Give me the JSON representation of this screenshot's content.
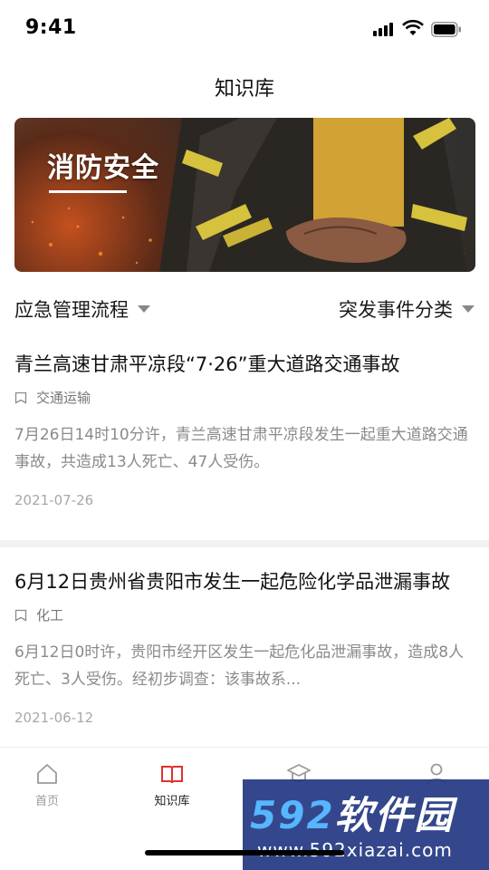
{
  "status": {
    "time": "9:41"
  },
  "header": {
    "title": "知识库"
  },
  "banner": {
    "text": "消防安全"
  },
  "filters": {
    "left": {
      "label": "应急管理流程"
    },
    "right": {
      "label": "突发事件分类"
    }
  },
  "articles": [
    {
      "title": "青兰高速甘肃平凉段“7·26”重大道路交通事故",
      "category": "交通运输",
      "summary": "7月26日14时10分许，青兰高速甘肃平凉段发生一起重大道路交通事故，共造成13人死亡、47人受伤。",
      "date": "2021-07-26"
    },
    {
      "title": "6月12日贵州省贵阳市发生一起危险化学品泄漏事故",
      "category": "化工",
      "summary": "6月12日0时许，贵阳市经开区发生一起危化品泄漏事故，造成8人死亡、3人受伤。经初步调查：该事故系...",
      "date": "2021-06-12"
    }
  ],
  "tabbar": {
    "items": [
      {
        "label": "首页",
        "icon": "home-icon"
      },
      {
        "label": "知识库",
        "icon": "book-icon"
      },
      {
        "label": "",
        "icon": "graduation-cap-icon"
      },
      {
        "label": "",
        "icon": "user-icon"
      }
    ],
    "active_color": "#e0322b"
  },
  "watermark": {
    "brand_num": "592",
    "brand_text": "软件园",
    "url": "www.592xiazai.com"
  }
}
